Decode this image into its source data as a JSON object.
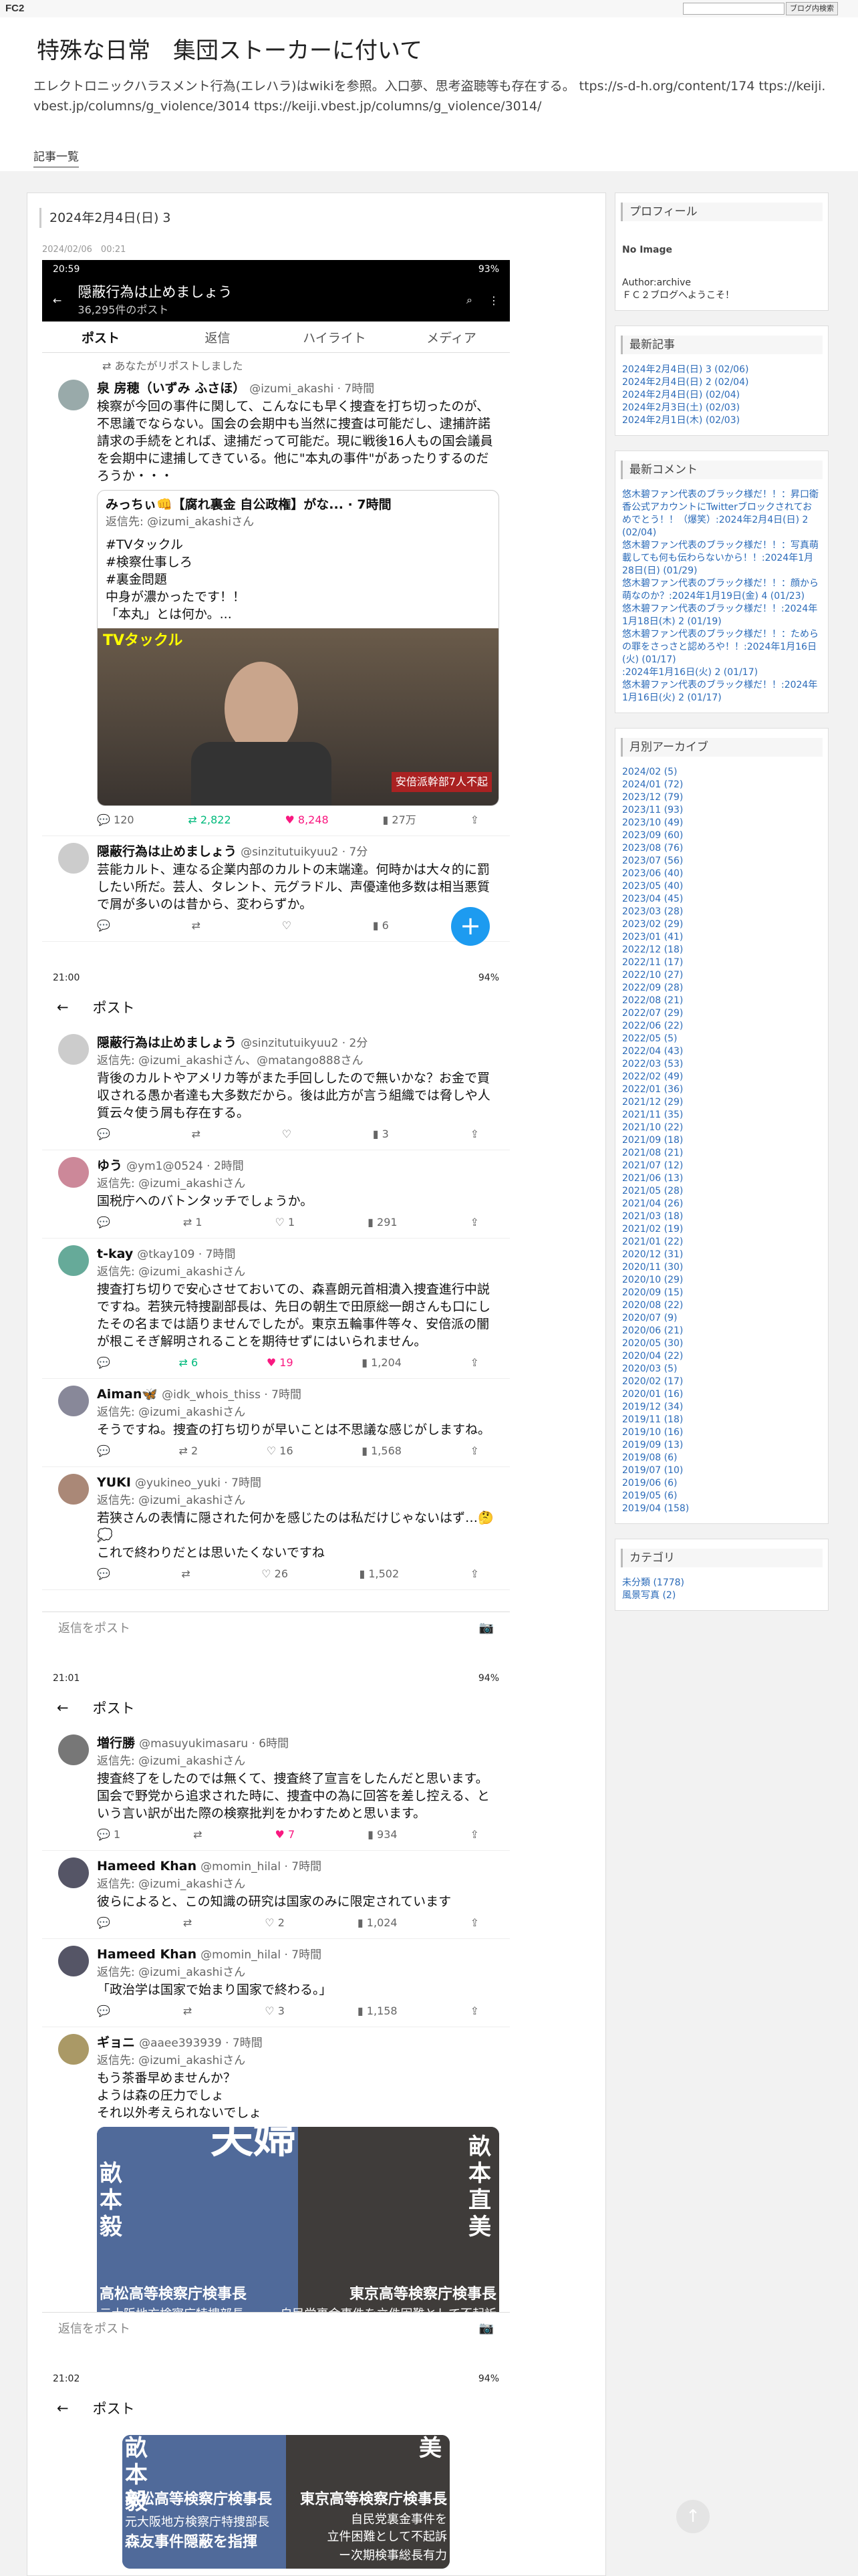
{
  "fc2": {
    "logo": "FC2",
    "button": "ブログ内検索"
  },
  "blog": {
    "title": "特殊な日常　集団ストーカーに付いて",
    "description": "エレクトロニックハラスメント行為(エレハラ)はwikiを参照。入口夢、思考盗聴等も存在する。 ttps://s-d-h.org/content/174 ttps://keiji.vbest.jp/columns/g_violence/3014 ttps://keiji.vbest.jp/columns/g_violence/3014/",
    "nav": "記事一覧"
  },
  "post": {
    "title": "2024年2月4日(日) 3",
    "date": "2024/02/06　00:21"
  },
  "screen1": {
    "status_time": "20:59",
    "status_right": "93%",
    "header_title": "隠蔽行為は止めましょう",
    "header_sub": "36,295件のポスト",
    "tabs": [
      "ポスト",
      "返信",
      "ハイライト",
      "メディア"
    ],
    "repost_note": "あなたがリポストしました",
    "tweet1": {
      "name": "泉 房穂（いずみ ふさほ）",
      "handle": "@izumi_akashi · 7時間",
      "text": "検察が今回の事件に関して、こんなにも早く捜査を打ち切ったのが、不思議でならない。国会の会期中も当然に捜査は可能だし、逮捕許諾請求の手続をとれば、逮捕だって可能だ。現に戦後16人もの国会議員を会期中に逮捕してきている。他に\"本丸の事件\"があったりするのだろうか・・・",
      "quote_name": "みっちぃ👊【腐れ裏金 自公政権】がな... · 7時間",
      "quote_reply": "返信先: @izumi_akashiさん",
      "quote_text": "#TVタックル\n#検察仕事しろ\n#裏金問題\n中身が濃かったです！！\n「本丸」とは何か。...",
      "photo_label": "TVタックル",
      "photo_caption": "安倍派幹部7人不起",
      "acts": [
        "120",
        "2,822",
        "8,248",
        "27万"
      ]
    },
    "tweet2": {
      "name": "隠蔽行為は止めましょう",
      "handle": "@sinzitutuikyuu2 · 7分",
      "text": "芸能カルト、連なる企業内部のカルトの末端達。何時かは大々的に罰したい所だ。芸人、タレント、元グラドル、声優達他多数は相当悪質で屑が多いのは昔から、変わらずか。",
      "acts": [
        "",
        "",
        "",
        "6"
      ]
    },
    "fab": "+"
  },
  "screen2": {
    "status_time": "21:00",
    "status_right": "94%",
    "header": "ポスト",
    "tweets": [
      {
        "name": "隠蔽行為は止めましょう",
        "handle": "@sinzitutuikyuu2 · 2分",
        "reply": "返信先: @izumi_akashiさん、@matango888さん",
        "text": "背後のカルトやアメリカ等がまた手回ししたので無いかな？お金で買収される愚か者達も大多数だから。後は此方が言う組織では脅しや人質云々使う屑も存在する。",
        "acts": [
          "",
          "",
          "",
          "3"
        ]
      },
      {
        "name": "ゆう",
        "handle": "@ym1@0524 · 2時間",
        "reply": "返信先: @izumi_akashiさん",
        "text": "国税庁へのバトンタッチでしょうか。",
        "acts": [
          "",
          "1",
          "1",
          "291"
        ]
      },
      {
        "name": "t-kay",
        "handle": "@tkay109 · 7時間",
        "reply": "返信先: @izumi_akashiさん",
        "text": "捜査打ち切りで安心させておいての、森喜朗元首相潰入捜査進行中説ですね。若狭元特捜副部長は、先日の朝生で田原総一朗さんも口にしたその名までは語りませんでしたが。東京五輪事件等々、安倍派の闇が根こそぎ解明されることを期待せずにはいられません。",
        "acts": [
          "",
          "6",
          "19",
          "1,204"
        ]
      },
      {
        "name": "Aiman🦋",
        "handle": "@idk_whois_thiss · 7時間",
        "reply": "返信先: @izumi_akashiさん",
        "text": "そうですね。捜査の打ち切りが早いことは不思議な感じがしますね。",
        "acts": [
          "",
          "2",
          "16",
          "1,568"
        ]
      },
      {
        "name": "YUKI",
        "handle": "@yukineo_yuki · 7時間",
        "reply": "返信先: @izumi_akashiさん",
        "text": "若狭さんの表情に隠された何かを感じたのは私だけじゃないはず…🤔💭\nこれで終わりだとは思いたくないですね",
        "acts": [
          "",
          "",
          "26",
          "1,502"
        ]
      }
    ],
    "reply_placeholder": "返信をポスト"
  },
  "screen3": {
    "status_time": "21:01",
    "status_right": "94%",
    "header": "ポスト",
    "tweets": [
      {
        "name": "増行勝",
        "handle": "@masuyukimasaru · 6時間",
        "reply": "返信先: @izumi_akashiさん",
        "text": "捜査終了をしたのでは無くて、捜査終了宣言をしたんだと思います。国会で野党から追求された時に、捜査中の為に回答を差し控える、という言い訳が出た際の検察批判をかわすためと思います。",
        "acts": [
          "1",
          "",
          "7",
          "934"
        ]
      },
      {
        "name": "Hameed Khan",
        "handle": "@momin_hilal · 7時間",
        "reply": "返信先: @izumi_akashiさん",
        "text": "彼らによると、この知識の研究は国家のみに限定されています",
        "acts": [
          "",
          "",
          "2",
          "1,024"
        ]
      },
      {
        "name": "Hameed Khan",
        "handle": "@momin_hilal · 7時間",
        "reply": "返信先: @izumi_akashiさん",
        "text": "「政治学は国家で始まり国家で終わる。」",
        "acts": [
          "",
          "",
          "3",
          "1,158"
        ]
      },
      {
        "name": "ギョニ",
        "handle": "@aaee393939 · 7時間",
        "reply": "返信先: @izumi_akashiさん",
        "text": "もう茶番早めませんか？\nようは森の圧力でしょ\nそれ以外考えられないでしょ",
        "acts": []
      }
    ],
    "image": {
      "big": "夫婦",
      "left_v": "畝本毅",
      "right_v": "畝本直美",
      "left_cap": "高松高等検察庁検事長",
      "left_cap2": "元大阪地方検察庁特捜部長",
      "right_cap": "東京高等検察庁検事長",
      "right_cap2": "自民党裏金事件を立件困難として不起訴"
    },
    "reply_placeholder": "返信をポスト"
  },
  "screen4": {
    "status_time": "21:02",
    "status_right": "94%",
    "header": "ポスト",
    "image": {
      "left_v": "畝本毅",
      "right_v": "美",
      "left_cap": "高松高等検察庁検事長",
      "left_cap2": "元大阪地方検察庁特捜部長",
      "left_cap3": "森友事件隠蔽を指揮",
      "right_cap": "東京高等検察庁検事長",
      "right_cap2": "自民党裏金事件を",
      "right_cap3": "立件困難として不起訴",
      "right_cap4": "ー次期検事総長有力"
    }
  },
  "sidebar": {
    "profile": {
      "title": "プロフィール",
      "noimage": "No Image",
      "author": "Author:archive",
      "greeting": "ＦＣ２ブログへようこそ！"
    },
    "recent": {
      "title": "最新記事",
      "items": [
        "2024年2月4日(日) 3 (02/06)",
        "2024年2月4日(日) 2 (02/04)",
        "2024年2月4日(日) (02/04)",
        "2024年2月3日(土) (02/03)",
        "2024年2月1日(木) (02/03)"
      ]
    },
    "comments": {
      "title": "最新コメント",
      "items": [
        "悠木碧ファン代表のブラック様だ！！：昇口衛香公式アカウントにTwitterブロックされておめでとう！！（爆笑）:2024年2月4日(日) 2 (02/04)",
        "悠木碧ファン代表のブラック様だ！！：写真萌載しても何も伝わらないから！！:2024年1月28日(日) (01/29)",
        "悠木碧ファン代表のブラック様だ！！：顔から萌なのか？:2024年1月19日(金) 4 (01/23)",
        "悠木碧ファン代表のブラック様だ！！:2024年1月18日(木) 2 (01/19)",
        "悠木碧ファン代表のブラック様だ！！：ためらの罪をさっさと認めろや！！:2024年1月16日(火) (01/17)",
        ":2024年1月16日(火) 2 (01/17)",
        "悠木碧ファン代表のブラック様だ！！:2024年1月16日(火) 2 (01/17)"
      ]
    },
    "archive": {
      "title": "月別アーカイブ",
      "items": [
        "2024/02 (5)",
        "2024/01 (72)",
        "2023/12 (79)",
        "2023/11 (93)",
        "2023/10 (49)",
        "2023/09 (60)",
        "2023/08 (76)",
        "2023/07 (56)",
        "2023/06 (40)",
        "2023/05 (40)",
        "2023/04 (45)",
        "2023/03 (28)",
        "2023/02 (29)",
        "2023/01 (41)",
        "2022/12 (18)",
        "2022/11 (17)",
        "2022/10 (27)",
        "2022/09 (28)",
        "2022/08 (21)",
        "2022/07 (29)",
        "2022/06 (22)",
        "2022/05 (5)",
        "2022/04 (43)",
        "2022/03 (53)",
        "2022/02 (49)",
        "2022/01 (36)",
        "2021/12 (29)",
        "2021/11 (35)",
        "2021/10 (22)",
        "2021/09 (18)",
        "2021/08 (21)",
        "2021/07 (12)",
        "2021/06 (13)",
        "2021/05 (28)",
        "2021/04 (26)",
        "2021/03 (18)",
        "2021/02 (19)",
        "2021/01 (22)",
        "2020/12 (31)",
        "2020/11 (30)",
        "2020/10 (29)",
        "2020/09 (15)",
        "2020/08 (22)",
        "2020/07 (9)",
        "2020/06 (21)",
        "2020/05 (30)",
        "2020/04 (22)",
        "2020/03 (5)",
        "2020/02 (17)",
        "2020/01 (16)",
        "2019/12 (34)",
        "2019/11 (18)",
        "2019/10 (16)",
        "2019/09 (13)",
        "2019/08 (6)",
        "2019/07 (10)",
        "2019/06 (6)",
        "2019/05 (6)",
        "2019/04 (158)"
      ]
    },
    "category": {
      "title": "カテゴリ",
      "items": [
        "未分類 (1778)",
        "風景写真 (2)"
      ]
    }
  },
  "totop": "↑"
}
